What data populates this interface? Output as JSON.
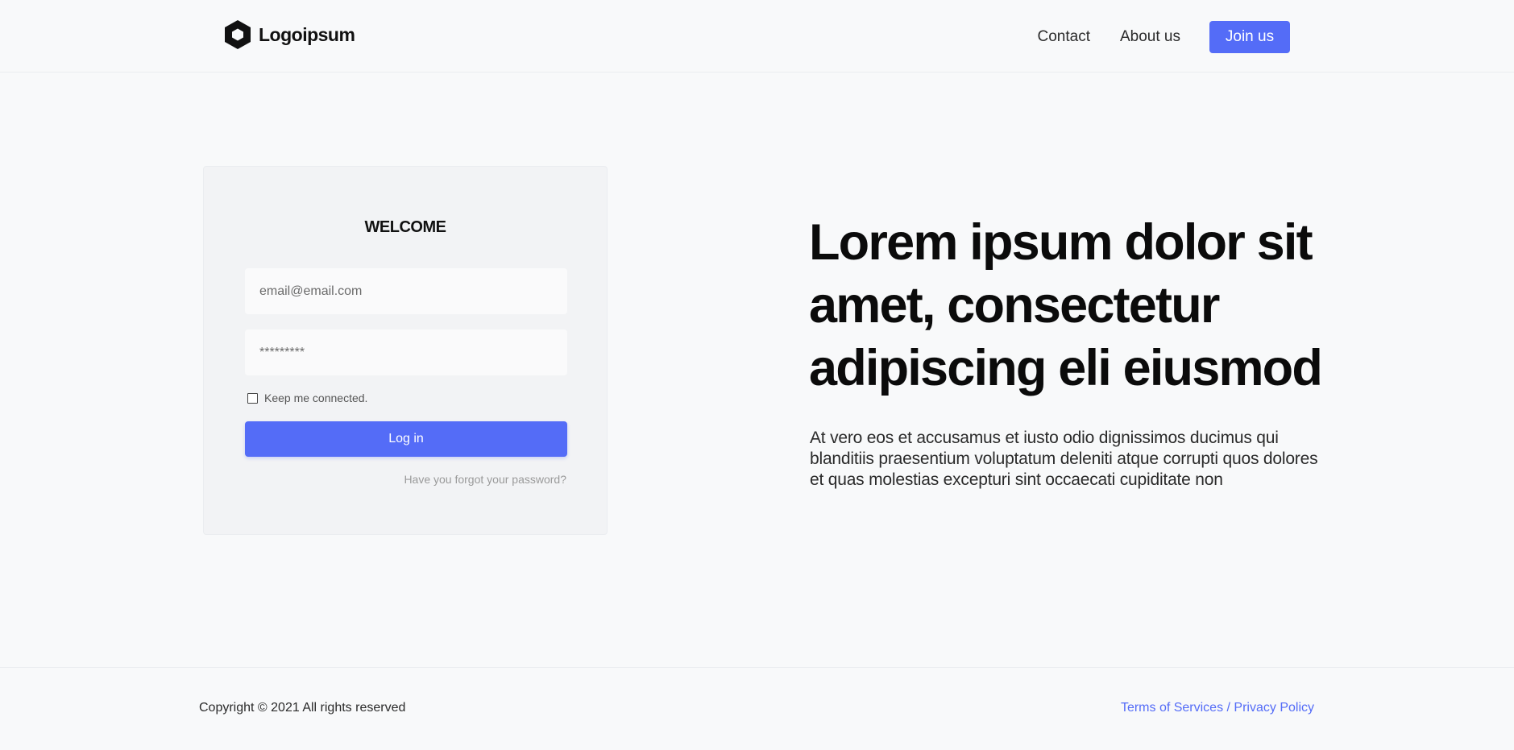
{
  "header": {
    "logo_text": "Logoipsum",
    "nav": {
      "contact": "Contact",
      "about": "About us",
      "join": "Join us"
    }
  },
  "login": {
    "title": "WELCOME",
    "email_placeholder": "email@email.com",
    "password_placeholder": "*********",
    "keep_connected": "Keep me connected.",
    "login_button": "Log in",
    "forgot_password": "Have you forgot your password?"
  },
  "hero": {
    "title": "Lorem ipsum dolor sit amet, consectetur adipiscing eli eiusmod",
    "text": "At vero eos et accusamus et iusto odio dignissimos ducimus qui blanditiis praesentium voluptatum deleniti atque corrupti quos dolores et quas molestias excepturi sint occaecati cupiditate non"
  },
  "footer": {
    "copyright": "Copyright © 2021 All rights reserved",
    "terms": "Terms of Services",
    "separator": " / ",
    "privacy": "Privacy Policy"
  },
  "colors": {
    "accent": "#546cf7",
    "background": "#f8f9fa",
    "card": "#f2f3f5"
  },
  "icons": {
    "logo": "hexagon-logo-icon"
  }
}
